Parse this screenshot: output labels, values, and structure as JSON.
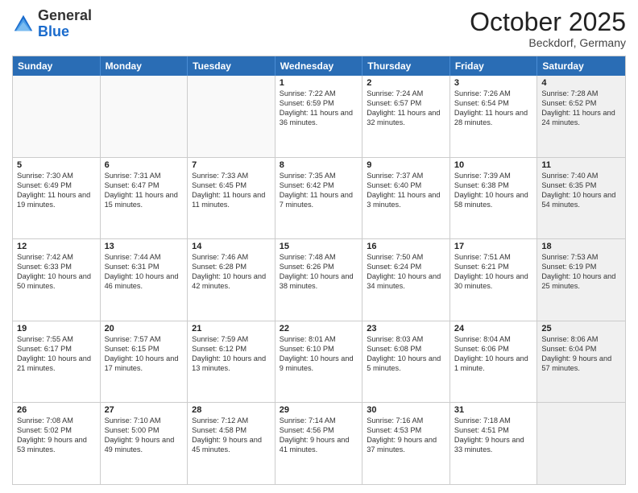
{
  "header": {
    "logo_general": "General",
    "logo_blue": "Blue",
    "month": "October 2025",
    "location": "Beckdorf, Germany"
  },
  "weekdays": [
    "Sunday",
    "Monday",
    "Tuesday",
    "Wednesday",
    "Thursday",
    "Friday",
    "Saturday"
  ],
  "rows": [
    [
      {
        "day": "",
        "sunrise": "",
        "sunset": "",
        "daylight": "",
        "shaded": false,
        "empty": true
      },
      {
        "day": "",
        "sunrise": "",
        "sunset": "",
        "daylight": "",
        "shaded": false,
        "empty": true
      },
      {
        "day": "",
        "sunrise": "",
        "sunset": "",
        "daylight": "",
        "shaded": false,
        "empty": true
      },
      {
        "day": "1",
        "sunrise": "Sunrise: 7:22 AM",
        "sunset": "Sunset: 6:59 PM",
        "daylight": "Daylight: 11 hours and 36 minutes.",
        "shaded": false,
        "empty": false
      },
      {
        "day": "2",
        "sunrise": "Sunrise: 7:24 AM",
        "sunset": "Sunset: 6:57 PM",
        "daylight": "Daylight: 11 hours and 32 minutes.",
        "shaded": false,
        "empty": false
      },
      {
        "day": "3",
        "sunrise": "Sunrise: 7:26 AM",
        "sunset": "Sunset: 6:54 PM",
        "daylight": "Daylight: 11 hours and 28 minutes.",
        "shaded": false,
        "empty": false
      },
      {
        "day": "4",
        "sunrise": "Sunrise: 7:28 AM",
        "sunset": "Sunset: 6:52 PM",
        "daylight": "Daylight: 11 hours and 24 minutes.",
        "shaded": true,
        "empty": false
      }
    ],
    [
      {
        "day": "5",
        "sunrise": "Sunrise: 7:30 AM",
        "sunset": "Sunset: 6:49 PM",
        "daylight": "Daylight: 11 hours and 19 minutes.",
        "shaded": false,
        "empty": false
      },
      {
        "day": "6",
        "sunrise": "Sunrise: 7:31 AM",
        "sunset": "Sunset: 6:47 PM",
        "daylight": "Daylight: 11 hours and 15 minutes.",
        "shaded": false,
        "empty": false
      },
      {
        "day": "7",
        "sunrise": "Sunrise: 7:33 AM",
        "sunset": "Sunset: 6:45 PM",
        "daylight": "Daylight: 11 hours and 11 minutes.",
        "shaded": false,
        "empty": false
      },
      {
        "day": "8",
        "sunrise": "Sunrise: 7:35 AM",
        "sunset": "Sunset: 6:42 PM",
        "daylight": "Daylight: 11 hours and 7 minutes.",
        "shaded": false,
        "empty": false
      },
      {
        "day": "9",
        "sunrise": "Sunrise: 7:37 AM",
        "sunset": "Sunset: 6:40 PM",
        "daylight": "Daylight: 11 hours and 3 minutes.",
        "shaded": false,
        "empty": false
      },
      {
        "day": "10",
        "sunrise": "Sunrise: 7:39 AM",
        "sunset": "Sunset: 6:38 PM",
        "daylight": "Daylight: 10 hours and 58 minutes.",
        "shaded": false,
        "empty": false
      },
      {
        "day": "11",
        "sunrise": "Sunrise: 7:40 AM",
        "sunset": "Sunset: 6:35 PM",
        "daylight": "Daylight: 10 hours and 54 minutes.",
        "shaded": true,
        "empty": false
      }
    ],
    [
      {
        "day": "12",
        "sunrise": "Sunrise: 7:42 AM",
        "sunset": "Sunset: 6:33 PM",
        "daylight": "Daylight: 10 hours and 50 minutes.",
        "shaded": false,
        "empty": false
      },
      {
        "day": "13",
        "sunrise": "Sunrise: 7:44 AM",
        "sunset": "Sunset: 6:31 PM",
        "daylight": "Daylight: 10 hours and 46 minutes.",
        "shaded": false,
        "empty": false
      },
      {
        "day": "14",
        "sunrise": "Sunrise: 7:46 AM",
        "sunset": "Sunset: 6:28 PM",
        "daylight": "Daylight: 10 hours and 42 minutes.",
        "shaded": false,
        "empty": false
      },
      {
        "day": "15",
        "sunrise": "Sunrise: 7:48 AM",
        "sunset": "Sunset: 6:26 PM",
        "daylight": "Daylight: 10 hours and 38 minutes.",
        "shaded": false,
        "empty": false
      },
      {
        "day": "16",
        "sunrise": "Sunrise: 7:50 AM",
        "sunset": "Sunset: 6:24 PM",
        "daylight": "Daylight: 10 hours and 34 minutes.",
        "shaded": false,
        "empty": false
      },
      {
        "day": "17",
        "sunrise": "Sunrise: 7:51 AM",
        "sunset": "Sunset: 6:21 PM",
        "daylight": "Daylight: 10 hours and 30 minutes.",
        "shaded": false,
        "empty": false
      },
      {
        "day": "18",
        "sunrise": "Sunrise: 7:53 AM",
        "sunset": "Sunset: 6:19 PM",
        "daylight": "Daylight: 10 hours and 25 minutes.",
        "shaded": true,
        "empty": false
      }
    ],
    [
      {
        "day": "19",
        "sunrise": "Sunrise: 7:55 AM",
        "sunset": "Sunset: 6:17 PM",
        "daylight": "Daylight: 10 hours and 21 minutes.",
        "shaded": false,
        "empty": false
      },
      {
        "day": "20",
        "sunrise": "Sunrise: 7:57 AM",
        "sunset": "Sunset: 6:15 PM",
        "daylight": "Daylight: 10 hours and 17 minutes.",
        "shaded": false,
        "empty": false
      },
      {
        "day": "21",
        "sunrise": "Sunrise: 7:59 AM",
        "sunset": "Sunset: 6:12 PM",
        "daylight": "Daylight: 10 hours and 13 minutes.",
        "shaded": false,
        "empty": false
      },
      {
        "day": "22",
        "sunrise": "Sunrise: 8:01 AM",
        "sunset": "Sunset: 6:10 PM",
        "daylight": "Daylight: 10 hours and 9 minutes.",
        "shaded": false,
        "empty": false
      },
      {
        "day": "23",
        "sunrise": "Sunrise: 8:03 AM",
        "sunset": "Sunset: 6:08 PM",
        "daylight": "Daylight: 10 hours and 5 minutes.",
        "shaded": false,
        "empty": false
      },
      {
        "day": "24",
        "sunrise": "Sunrise: 8:04 AM",
        "sunset": "Sunset: 6:06 PM",
        "daylight": "Daylight: 10 hours and 1 minute.",
        "shaded": false,
        "empty": false
      },
      {
        "day": "25",
        "sunrise": "Sunrise: 8:06 AM",
        "sunset": "Sunset: 6:04 PM",
        "daylight": "Daylight: 9 hours and 57 minutes.",
        "shaded": true,
        "empty": false
      }
    ],
    [
      {
        "day": "26",
        "sunrise": "Sunrise: 7:08 AM",
        "sunset": "Sunset: 5:02 PM",
        "daylight": "Daylight: 9 hours and 53 minutes.",
        "shaded": false,
        "empty": false
      },
      {
        "day": "27",
        "sunrise": "Sunrise: 7:10 AM",
        "sunset": "Sunset: 5:00 PM",
        "daylight": "Daylight: 9 hours and 49 minutes.",
        "shaded": false,
        "empty": false
      },
      {
        "day": "28",
        "sunrise": "Sunrise: 7:12 AM",
        "sunset": "Sunset: 4:58 PM",
        "daylight": "Daylight: 9 hours and 45 minutes.",
        "shaded": false,
        "empty": false
      },
      {
        "day": "29",
        "sunrise": "Sunrise: 7:14 AM",
        "sunset": "Sunset: 4:56 PM",
        "daylight": "Daylight: 9 hours and 41 minutes.",
        "shaded": false,
        "empty": false
      },
      {
        "day": "30",
        "sunrise": "Sunrise: 7:16 AM",
        "sunset": "Sunset: 4:53 PM",
        "daylight": "Daylight: 9 hours and 37 minutes.",
        "shaded": false,
        "empty": false
      },
      {
        "day": "31",
        "sunrise": "Sunrise: 7:18 AM",
        "sunset": "Sunset: 4:51 PM",
        "daylight": "Daylight: 9 hours and 33 minutes.",
        "shaded": false,
        "empty": false
      },
      {
        "day": "",
        "sunrise": "",
        "sunset": "",
        "daylight": "",
        "shaded": true,
        "empty": true
      }
    ]
  ]
}
